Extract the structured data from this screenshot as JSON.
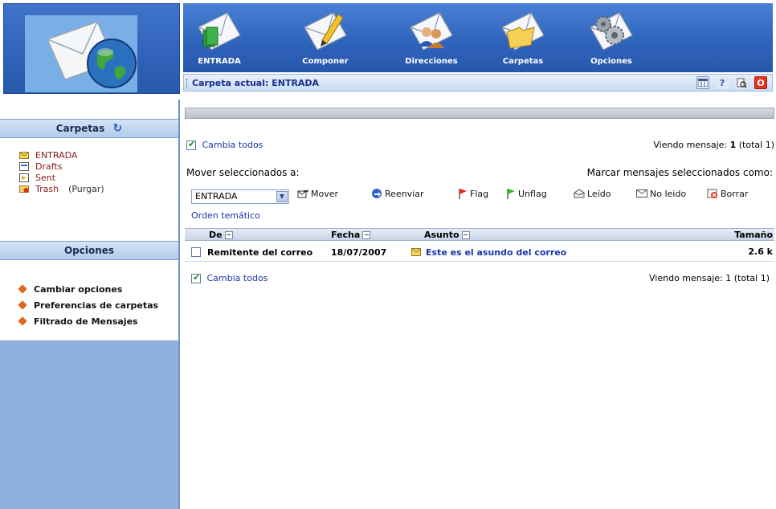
{
  "nav": {
    "items": [
      {
        "label": "ENTRADA",
        "icon": "inbox-envelope-icon"
      },
      {
        "label": "Componer",
        "icon": "compose-envelope-icon"
      },
      {
        "label": "Direcciones",
        "icon": "addresses-envelope-icon"
      },
      {
        "label": "Carpetas",
        "icon": "folders-envelope-icon"
      },
      {
        "label": "Opciones",
        "icon": "options-gears-icon"
      }
    ]
  },
  "status": {
    "current_folder": "Carpeta actual: ENTRADA"
  },
  "sidebar": {
    "folders_title": "Carpetas",
    "folders": [
      {
        "name": "ENTRADA"
      },
      {
        "name": "Drafts"
      },
      {
        "name": "Sent"
      },
      {
        "name": "Trash",
        "extra": "(Purgar)"
      }
    ],
    "options_title": "Opciones",
    "options": [
      {
        "label": "Cambiar opciones"
      },
      {
        "label": "Preferencias de carpetas"
      },
      {
        "label": "Filtrado de Mensajes"
      }
    ]
  },
  "main": {
    "toggle_all_top": "Cambia todos",
    "viewing_top_prefix": "Viendo mensaje: ",
    "viewing_top_num": "1",
    "viewing_top_suffix": " (total 1)",
    "move_label": "Mover seleccionados a:",
    "mark_label": "Marcar mensajes seleccionados como:",
    "select_value": "ENTRADA",
    "move_button": "Mover",
    "forward_button": "Reenviar",
    "thread_link": "Orden temático",
    "actions": {
      "flag": "Flag",
      "unflag": "Unflag",
      "read": "Leído",
      "unread": "No leido",
      "delete": "Borrar"
    },
    "columns": {
      "from": "De",
      "date": "Fecha",
      "subject": "Asunto",
      "size": "Tamaño"
    },
    "messages": [
      {
        "from": "Remitente del correo",
        "date": "18/07/2007",
        "subject": "Este es el asundo del correo",
        "size": "2.6 k"
      }
    ],
    "toggle_all_bottom": "Cambia todos",
    "viewing_bottom_prefix": "Viendo mensaje: ",
    "viewing_bottom_num": "1",
    "viewing_bottom_suffix": " (total 1)"
  }
}
